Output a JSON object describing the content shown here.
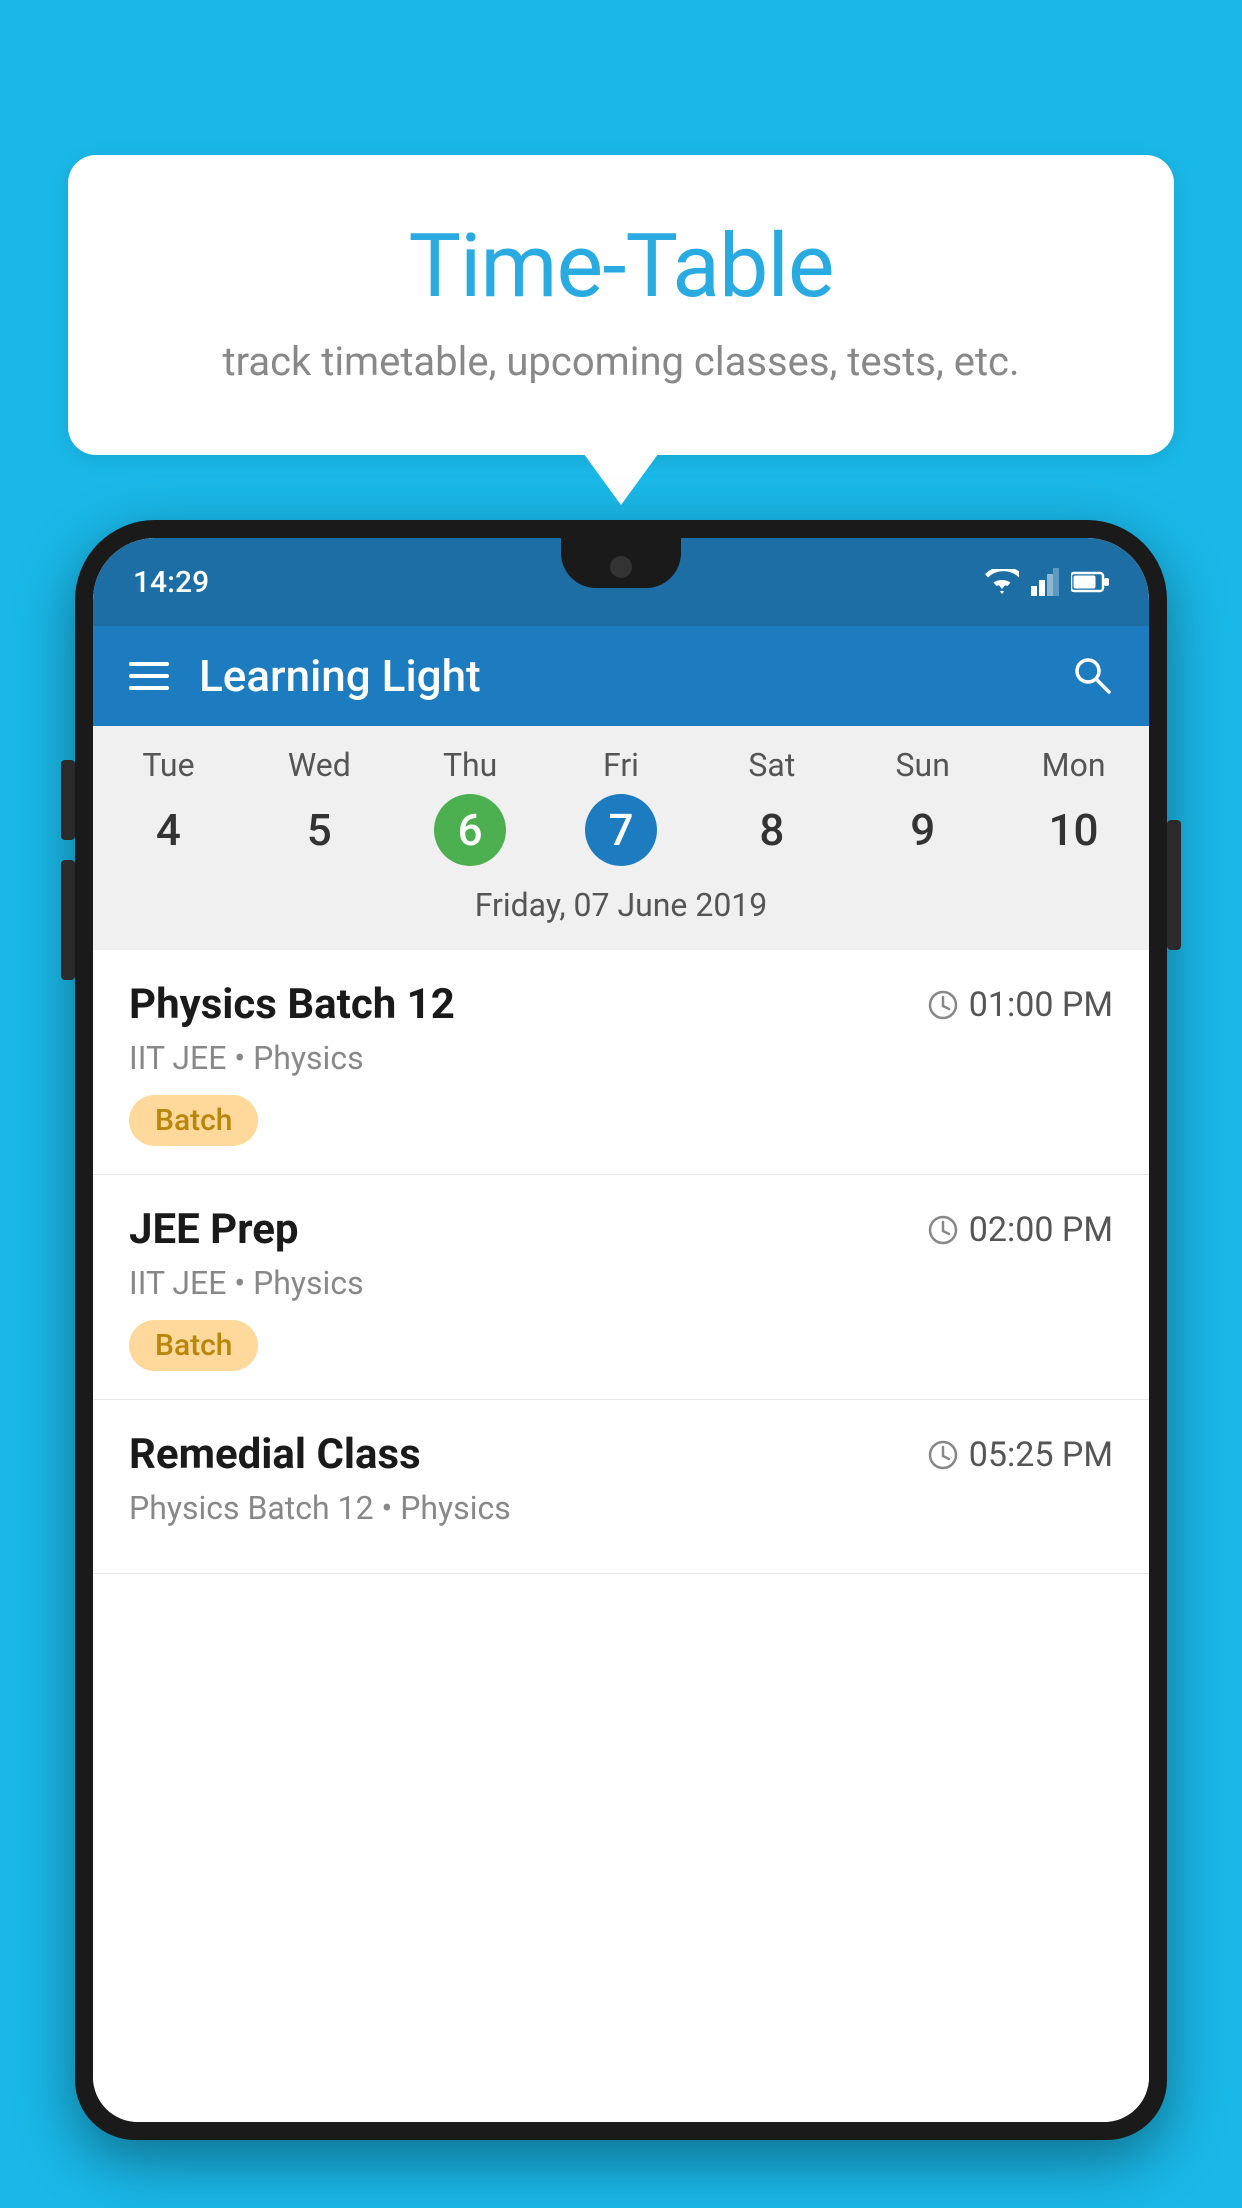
{
  "background_color": "#1ab8e8",
  "bubble": {
    "title": "Time-Table",
    "subtitle": "track timetable, upcoming classes, tests, etc."
  },
  "phone": {
    "status_bar": {
      "time": "14:29"
    },
    "app_bar": {
      "title": "Learning Light"
    },
    "calendar": {
      "days": [
        "Tue",
        "Wed",
        "Thu",
        "Fri",
        "Sat",
        "Sun",
        "Mon"
      ],
      "numbers": [
        "4",
        "5",
        "6",
        "7",
        "8",
        "9",
        "10"
      ],
      "today_index": 2,
      "selected_index": 3,
      "selected_date_label": "Friday, 07 June 2019"
    },
    "schedule": [
      {
        "title": "Physics Batch 12",
        "time": "01:00 PM",
        "sub": "IIT JEE • Physics",
        "badge": "Batch"
      },
      {
        "title": "JEE Prep",
        "time": "02:00 PM",
        "sub": "IIT JEE • Physics",
        "badge": "Batch"
      },
      {
        "title": "Remedial Class",
        "time": "05:25 PM",
        "sub": "Physics Batch 12 • Physics",
        "badge": null
      }
    ]
  }
}
